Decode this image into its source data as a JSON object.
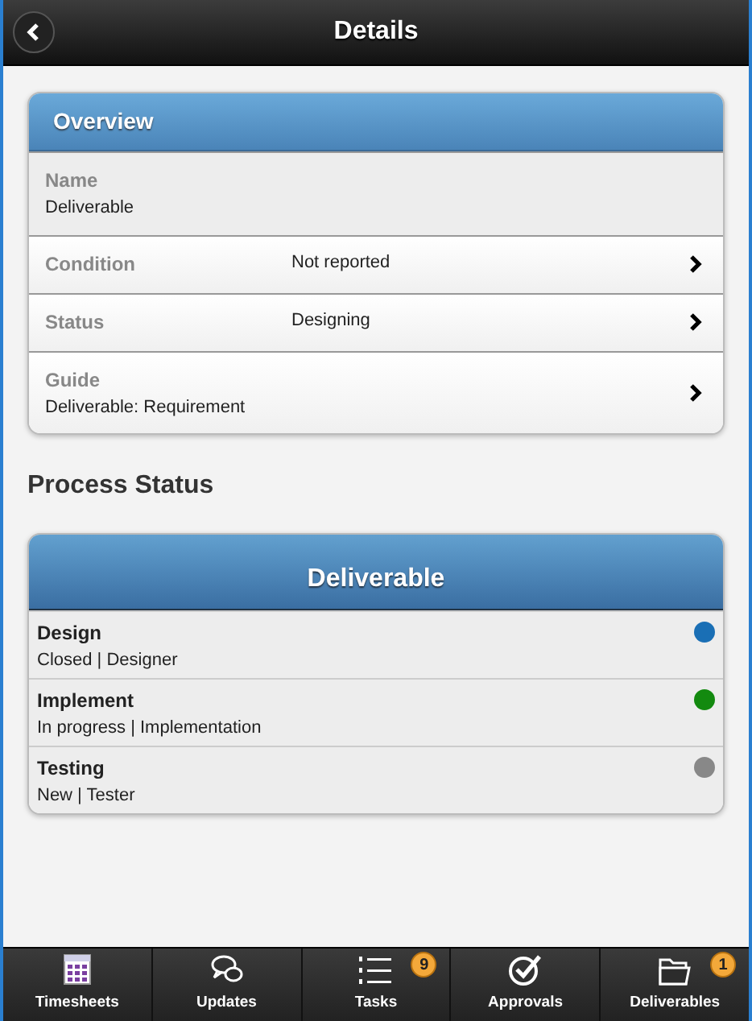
{
  "header": {
    "title": "Details"
  },
  "overview": {
    "title": "Overview",
    "rows": [
      {
        "kind": "stacked",
        "label": "Name",
        "value": "Deliverable",
        "linked": false
      },
      {
        "kind": "inline",
        "label": "Condition",
        "value": "Not reported",
        "linked": true
      },
      {
        "kind": "inline",
        "label": "Status",
        "value": "Designing",
        "linked": true
      },
      {
        "kind": "stacked",
        "label": "Guide",
        "value": "Deliverable: Requirement",
        "linked": true
      }
    ]
  },
  "process": {
    "heading": "Process Status",
    "title": "Deliverable",
    "steps": [
      {
        "name": "Design",
        "state": "Closed",
        "sep": "|",
        "role": "Designer",
        "color": "#1a6fb5"
      },
      {
        "name": "Implement",
        "state": "In progress",
        "sep": "|",
        "role": "Implementation",
        "color": "#138a0f"
      },
      {
        "name": "Testing",
        "state": "New",
        "sep": "|",
        "role": "Tester",
        "color": "#888888"
      }
    ]
  },
  "tabbar": [
    {
      "kind": "timesheets",
      "label": "Timesheets"
    },
    {
      "kind": "updates",
      "label": "Updates"
    },
    {
      "kind": "tasks",
      "label": "Tasks",
      "badge": "9"
    },
    {
      "kind": "approvals",
      "label": "Approvals"
    },
    {
      "kind": "deliverables",
      "label": "Deliverables",
      "badge": "1"
    }
  ]
}
